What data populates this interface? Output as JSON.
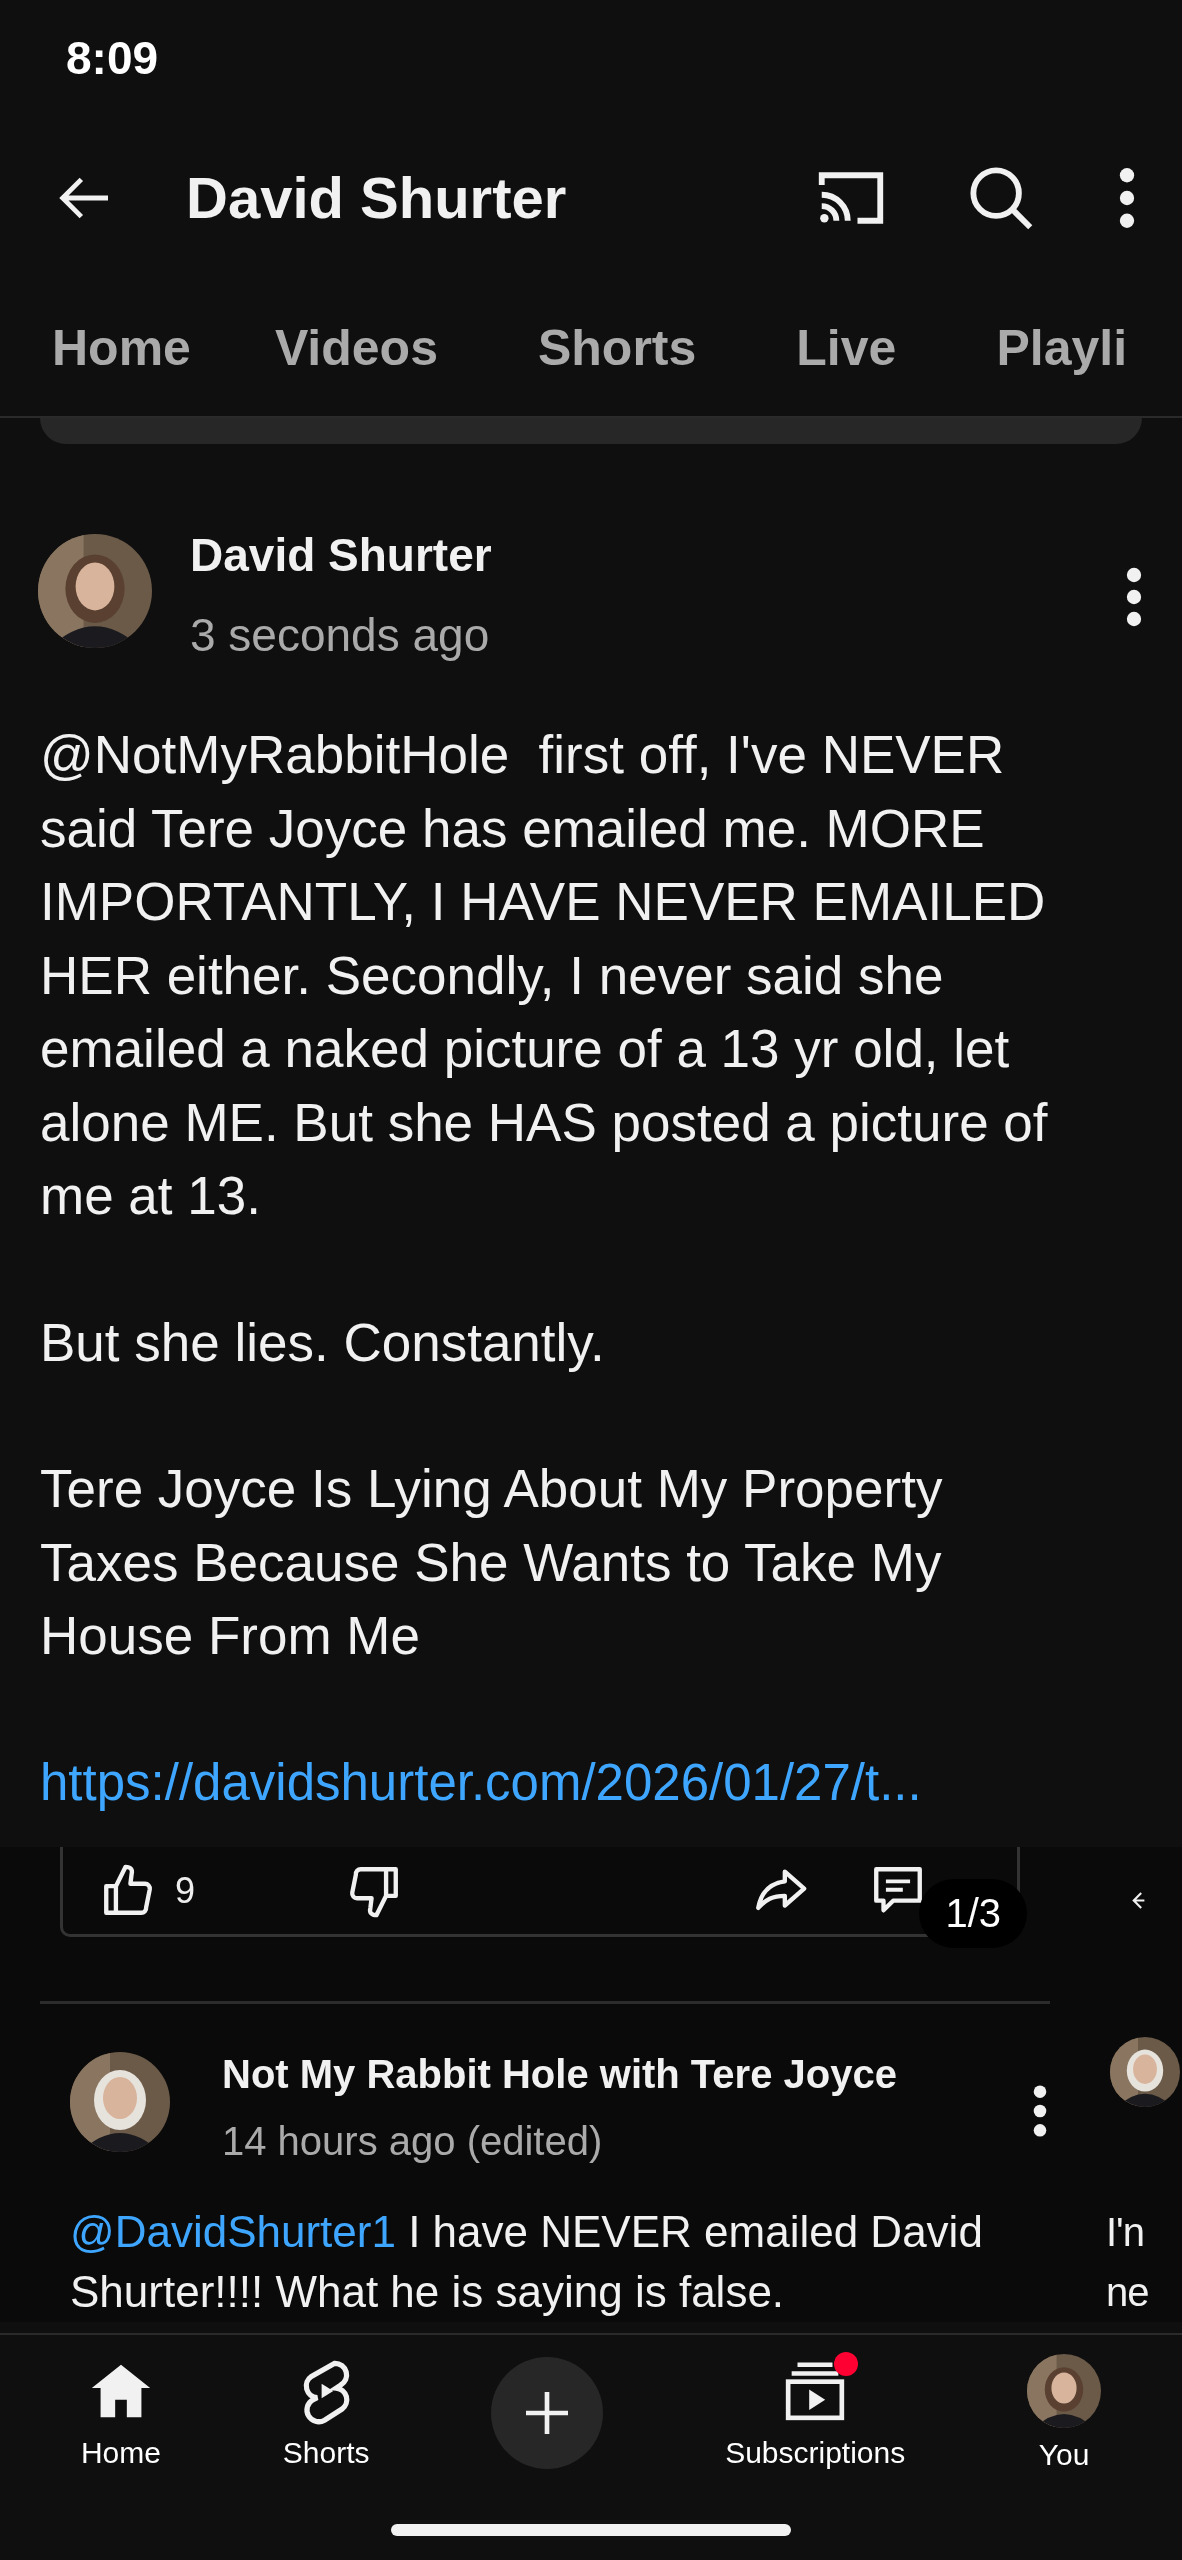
{
  "status_bar": {
    "time": "8:09"
  },
  "app_bar": {
    "title": "David Shurter"
  },
  "tabs": [
    {
      "label": "Home"
    },
    {
      "label": "Videos"
    },
    {
      "label": "Shorts"
    },
    {
      "label": "Live"
    },
    {
      "label": "Playli"
    }
  ],
  "post": {
    "author": "David Shurter",
    "time": "3 seconds ago",
    "paragraphs": [
      "@NotMyRabbitHole  first off, I've NEVER said Tere Joyce has emailed me. MORE IMPORTANTLY, I HAVE NEVER EMAILED HER either. Secondly, I never said she emailed a naked picture of a 13 yr old, let alone ME. But she HAS posted a picture of me at 13.",
      "But she lies. Constantly.",
      "Tere Joyce Is Lying About My Property Taxes Because She Wants to Take My House From Me"
    ],
    "link": "https://davidshurter.com/2026/01/27/t..."
  },
  "image_carousel": {
    "counter": "1/3",
    "slide": {
      "like_count": "9",
      "comment": {
        "author": "Not My Rabbit Hole with Tere Joyce",
        "time": "14 hours ago (edited)",
        "mention": "@DavidShurter1",
        "text": "I have NEVER emailed David Shurter!!!! What he is saying is false."
      }
    },
    "next_slide_peek": {
      "lines": [
        "I'n",
        "ne"
      ]
    }
  },
  "bottom_nav": [
    {
      "kind": "home",
      "label": "Home",
      "notification": false
    },
    {
      "kind": "shorts",
      "label": "Shorts",
      "notification": false
    },
    {
      "kind": "create",
      "notification": false
    },
    {
      "kind": "subscriptions",
      "label": "Subscriptions",
      "notification": true
    },
    {
      "kind": "you",
      "label": "You",
      "notification": false
    }
  ]
}
